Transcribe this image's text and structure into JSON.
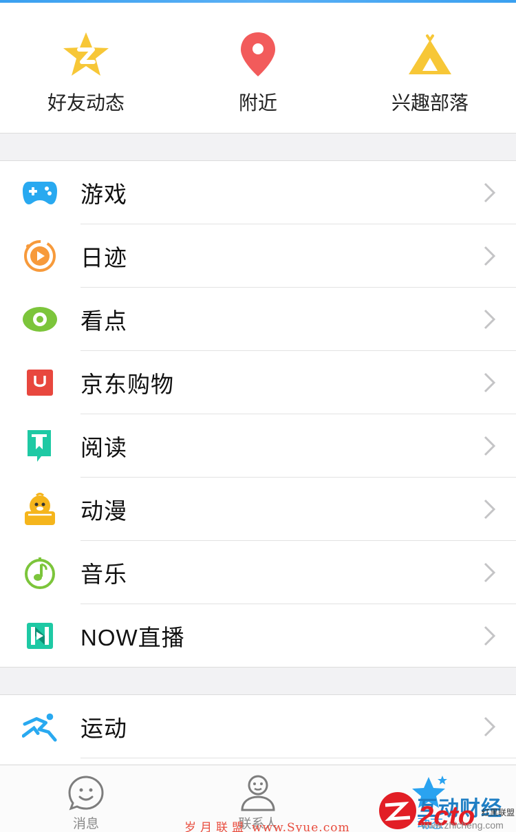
{
  "quick_actions": [
    {
      "label": "好友动态",
      "icon": "qzone-star-icon",
      "color": "#f7c737"
    },
    {
      "label": "附近",
      "icon": "location-pin-icon",
      "color": "#f25b5b"
    },
    {
      "label": "兴趣部落",
      "icon": "tent-icon",
      "color": "#f7c737"
    }
  ],
  "list1": [
    {
      "label": "游戏",
      "icon": "gamepad-icon",
      "color": "#29a9f0"
    },
    {
      "label": "日迹",
      "icon": "play-circle-icon",
      "color": "#f79a3b"
    },
    {
      "label": "看点",
      "icon": "eye-icon",
      "color": "#7cc53b"
    },
    {
      "label": "京东购物",
      "icon": "jd-bag-icon",
      "color": "#e8473e"
    },
    {
      "label": "阅读",
      "icon": "bookmark-book-icon",
      "color": "#1ec9a4"
    },
    {
      "label": "动漫",
      "icon": "penguin-icon",
      "color": "#f5b51c"
    },
    {
      "label": "音乐",
      "icon": "music-note-icon",
      "color": "#7cc53b"
    },
    {
      "label": "NOW直播",
      "icon": "now-live-icon",
      "color": "#1ec9a4"
    }
  ],
  "list2": [
    {
      "label": "运动",
      "icon": "running-icon",
      "color": "#29a9f0"
    }
  ],
  "tabs": [
    {
      "label": "消息",
      "icon": "smiley-bubble-icon",
      "active": false
    },
    {
      "label": "联系人",
      "icon": "person-icon",
      "active": false
    },
    {
      "label": "动态",
      "icon": "star-icon",
      "active": true
    }
  ],
  "watermarks": {
    "text1": "岁月联盟",
    "url1": "www.Syue.com",
    "text2": "互动财经",
    "url2": "www.zhicheng.com",
    "logo2": "2cto",
    "text3": "红黑联盟"
  }
}
